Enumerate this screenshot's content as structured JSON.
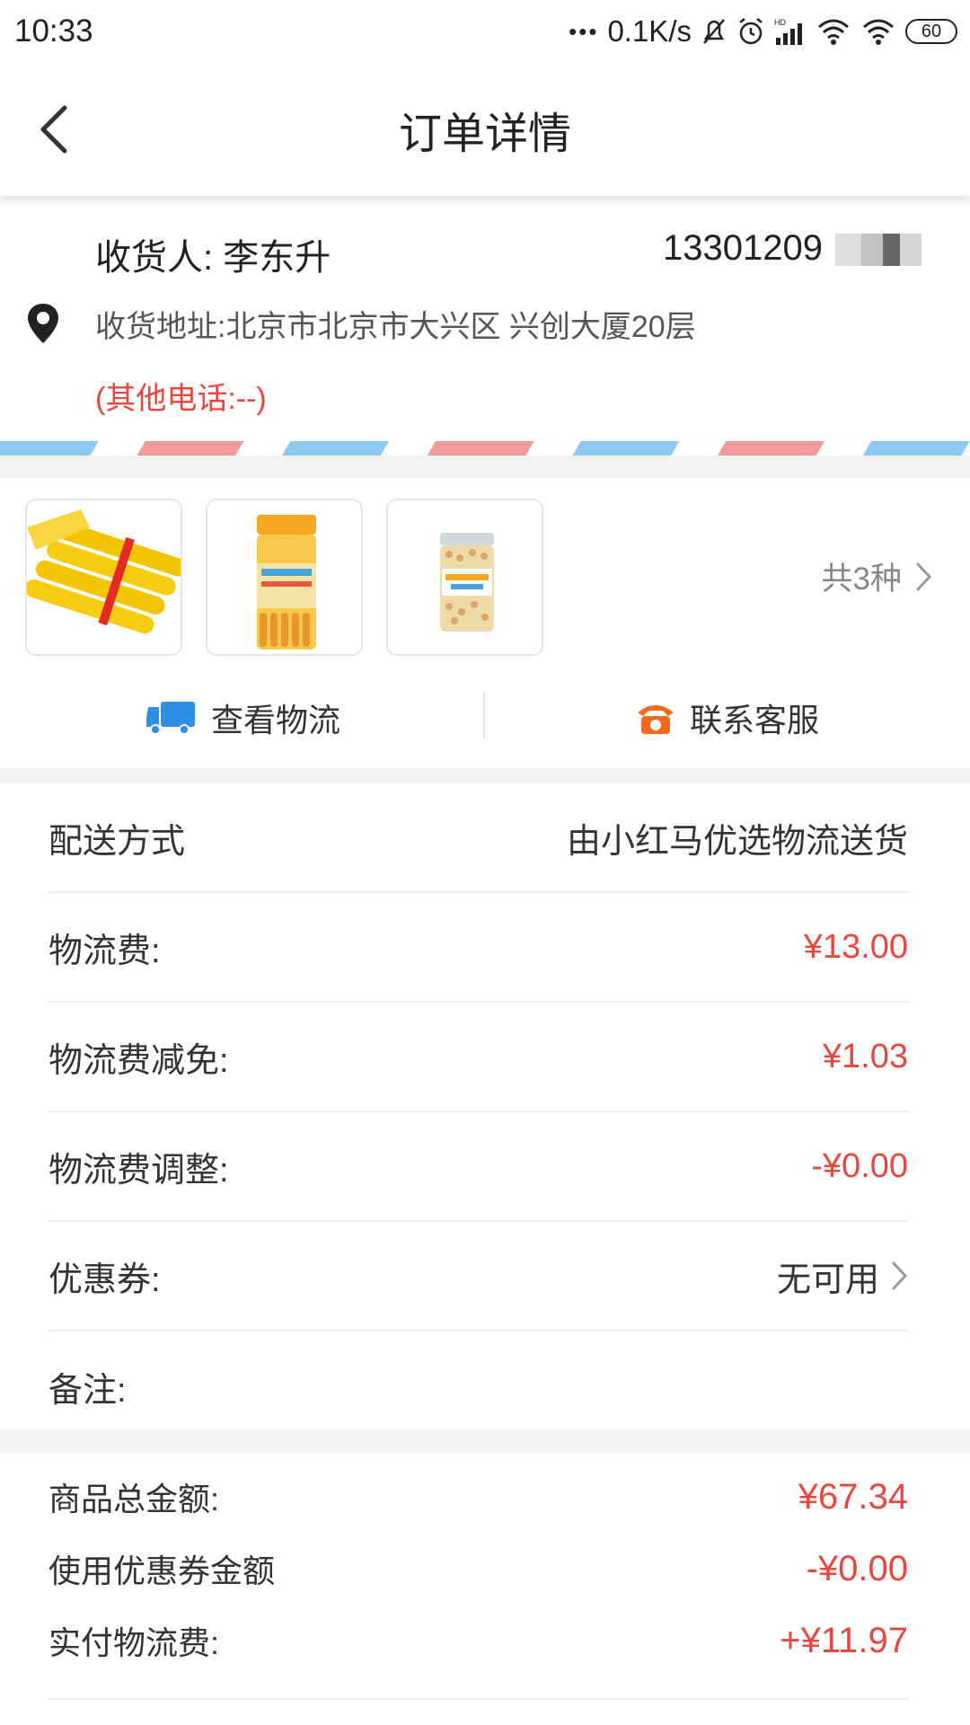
{
  "status_bar": {
    "time": "10:33",
    "dots": "•••",
    "net_speed": "0.1K/s",
    "battery": "60"
  },
  "nav": {
    "title": "订单详情"
  },
  "address": {
    "receiver": "收货人: 李东升",
    "phone": "13301209",
    "line": "收货地址:北京市北京市大兴区 兴创大厦20层",
    "other_phone": "(其他电话:--)"
  },
  "products": {
    "count_label": "共3种",
    "items": [
      {
        "name": "sausage-product"
      },
      {
        "name": "sausage-jar-product"
      },
      {
        "name": "puffs-jar-product"
      }
    ]
  },
  "actions": {
    "logistics": "查看物流",
    "service": "联系客服"
  },
  "order_rows": {
    "delivery_label": "配送方式",
    "delivery_value": "由小红马优选物流送货",
    "fee_label": "物流费:",
    "fee_value": "¥13.00",
    "discount_label": "物流费减免:",
    "discount_value": "¥1.03",
    "adjust_label": "物流费调整:",
    "adjust_value": "-¥0.00",
    "coupon_label": "优惠券:",
    "coupon_value": "无可用",
    "remark_label": "备注:"
  },
  "summary": {
    "goods_total_label": "商品总金额:",
    "goods_total_value": "¥67.34",
    "coupon_used_label": "使用优惠券金额",
    "coupon_used_value": "-¥0.00",
    "paid_fee_label": "实付物流费:",
    "paid_fee_value": "+¥11.97"
  },
  "colors": {
    "accent_red": "#e8473f",
    "truck_blue": "#2f8fe6",
    "phone_orange": "#f26b1d"
  }
}
